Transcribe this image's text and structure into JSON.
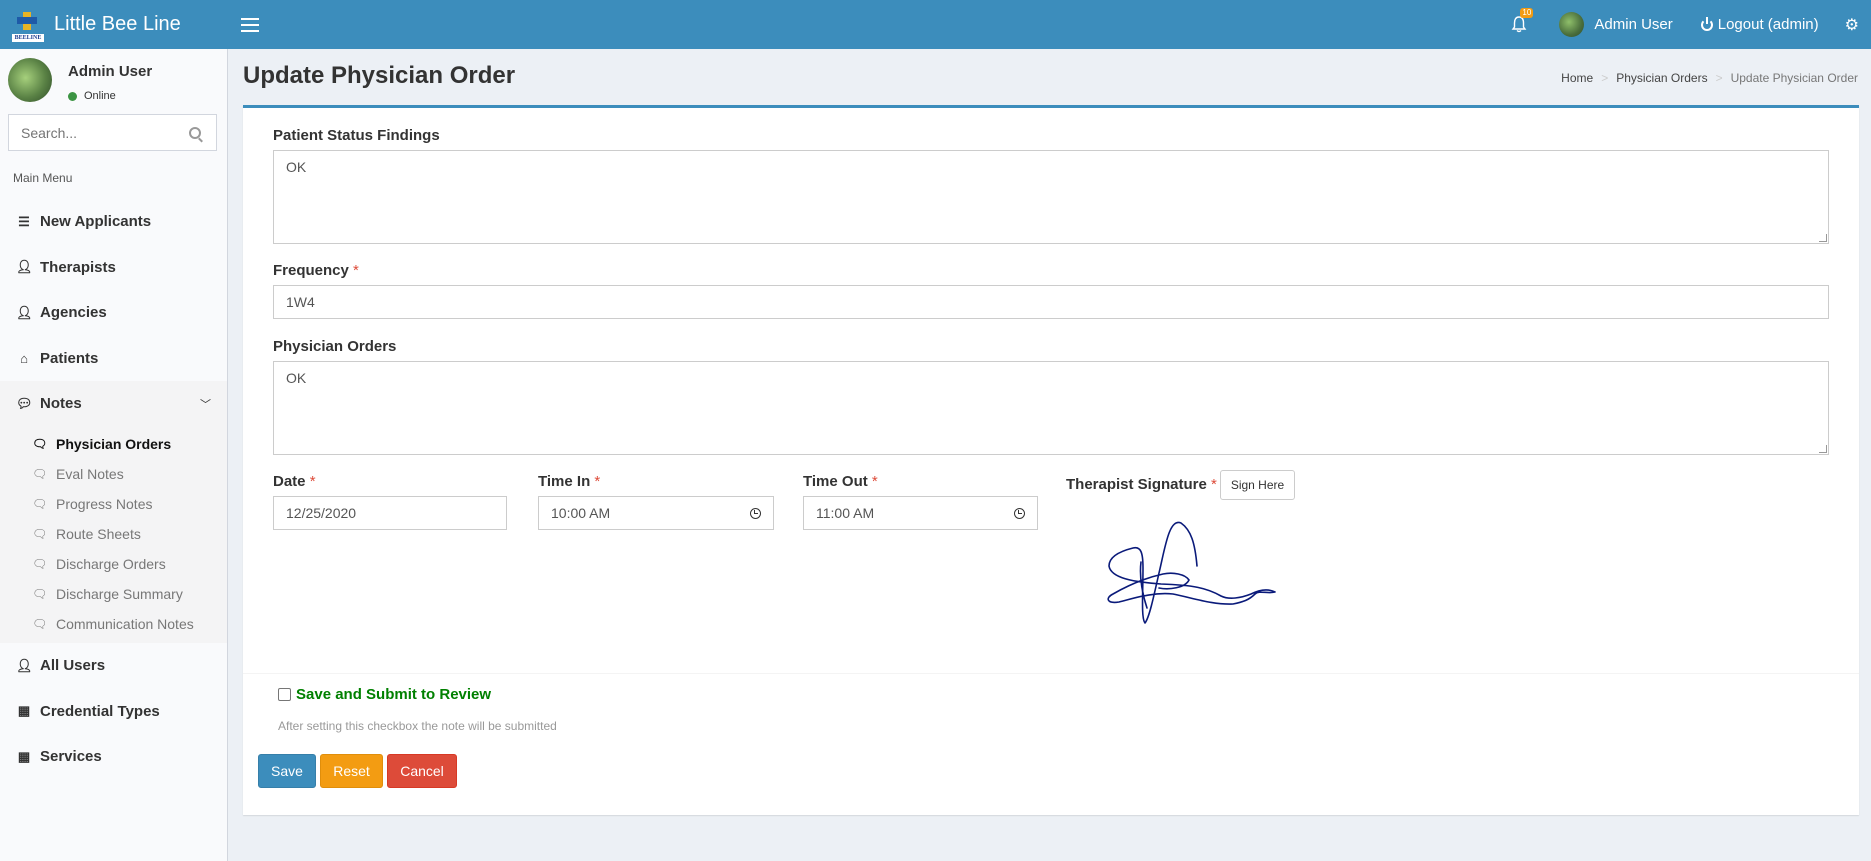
{
  "app": {
    "brand_logo_text": "BEELINE",
    "brand_name": "Little Bee Line"
  },
  "topbar": {
    "notification_count": "10",
    "user_name": "Admin User",
    "logout_label": "Logout (admin)"
  },
  "sidebar": {
    "user_name": "Admin User",
    "status": "Online",
    "search_placeholder": "Search...",
    "menu_header": "Main Menu",
    "items": [
      {
        "label": "New Applicants",
        "icon": "list-icon"
      },
      {
        "label": "Therapists",
        "icon": "user-icon"
      },
      {
        "label": "Agencies",
        "icon": "user-icon"
      },
      {
        "label": "Patients",
        "icon": "home-icon"
      },
      {
        "label": "Notes",
        "icon": "comments-icon"
      },
      {
        "label": "All Users",
        "icon": "user-icon"
      },
      {
        "label": "Credential Types",
        "icon": "grid-icon"
      },
      {
        "label": "Services",
        "icon": "grid-icon"
      }
    ],
    "notes_submenu": [
      "Physician Orders",
      "Eval Notes",
      "Progress Notes",
      "Route Sheets",
      "Discharge Orders",
      "Discharge Summary",
      "Communication Notes"
    ]
  },
  "page": {
    "title": "Update Physician Order",
    "breadcrumb": [
      "Home",
      "Physician Orders",
      "Update Physician Order"
    ]
  },
  "form": {
    "patient_status_label": "Patient Status Findings",
    "patient_status_value": "OK",
    "frequency_label": "Frequency",
    "frequency_value": "1W4",
    "physician_orders_label": "Physician Orders",
    "physician_orders_value": "OK",
    "date_label": "Date",
    "date_value": "12/25/2020",
    "time_in_label": "Time In",
    "time_in_value": "10:00 AM",
    "time_out_label": "Time Out",
    "time_out_value": "11:00 AM",
    "signature_label": "Therapist Signature",
    "sign_here_label": "Sign Here",
    "required_mark": "*",
    "submit_checkbox_label": "Save and Submit to Review",
    "submit_checkbox_checked": false,
    "submit_help": "After setting this checkbox the note will be submitted",
    "save_label": "Save",
    "reset_label": "Reset",
    "cancel_label": "Cancel"
  },
  "colors": {
    "primary": "#3c8dbc",
    "warning": "#f39c12",
    "danger": "#dd4b39",
    "success_text": "#008000",
    "signature_ink": "#0a1a7a"
  }
}
